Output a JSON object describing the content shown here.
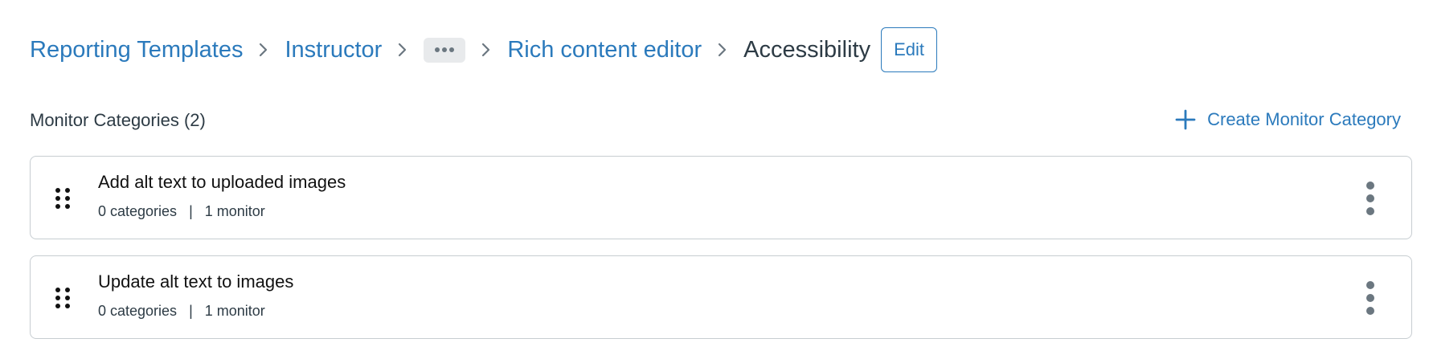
{
  "breadcrumb": {
    "items": [
      "Reporting Templates",
      "Instructor",
      "Rich content editor"
    ],
    "ellipsis_icon": "more-horizontal-icon",
    "separator_icon": "chevron-right-icon",
    "current": "Accessibility",
    "edit_label": "Edit"
  },
  "section": {
    "title": "Monitor Categories (2)",
    "create_label": "Create Monitor Category",
    "create_icon": "plus-icon"
  },
  "cards": [
    {
      "title": "Add alt text to uploaded images",
      "categories": "0 categories",
      "separator": "|",
      "monitors": "1 monitor",
      "drag_icon": "drag-handle-icon",
      "menu_icon": "kebab-menu-icon"
    },
    {
      "title": "Update alt text to images",
      "categories": "0 categories",
      "separator": "|",
      "monitors": "1 monitor",
      "drag_icon": "drag-handle-icon",
      "menu_icon": "kebab-menu-icon"
    }
  ],
  "colors": {
    "link": "#2b7abc",
    "text": "#2d3b45",
    "border": "#c7cdd1",
    "ellipsis_bg": "#e8eaec"
  }
}
